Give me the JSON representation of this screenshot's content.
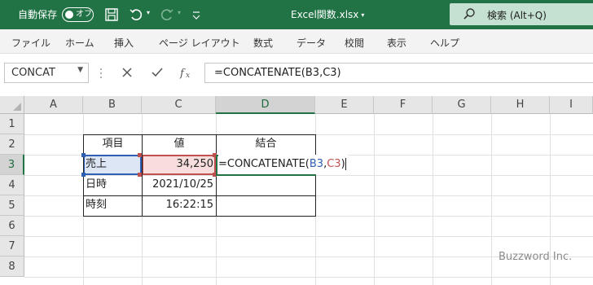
{
  "titlebar": {
    "autosave_label": "自動保存",
    "autosave_state": "オフ",
    "filename": "Excel関数.xlsx",
    "search_label": "検索 (Alt+Q)",
    "accent_color": "#217346"
  },
  "menu": {
    "items": [
      "ファイル",
      "ホーム",
      "挿入",
      "ページ レイアウト",
      "数式",
      "データ",
      "校閲",
      "表示",
      "ヘルプ"
    ]
  },
  "formula_bar": {
    "name_box": "CONCAT",
    "formula": "=CONCATENATE(B3,C3)"
  },
  "grid": {
    "columns": [
      "A",
      "B",
      "C",
      "D",
      "E",
      "F",
      "G",
      "H",
      "I"
    ],
    "rows": [
      "1",
      "2",
      "3",
      "4",
      "5",
      "6",
      "7",
      "8"
    ],
    "selected_column": "D",
    "selected_row": "3",
    "table": {
      "headers": [
        "項目",
        "値",
        "結合"
      ],
      "rows": [
        {
          "label": "売上",
          "value": "34,250"
        },
        {
          "label": "日時",
          "value": "2021/10/25"
        },
        {
          "label": "時刻",
          "value": "16:22:15"
        }
      ]
    },
    "edit_cell": {
      "prefix": "=CONCATENATE(",
      "ref1": "B3",
      "sep": ",",
      "ref2": "C3",
      "suffix": ")"
    },
    "ref_colors": {
      "ref1": "#2f5fb3",
      "ref2": "#c0504d"
    }
  },
  "watermark": "Buzzword Inc."
}
